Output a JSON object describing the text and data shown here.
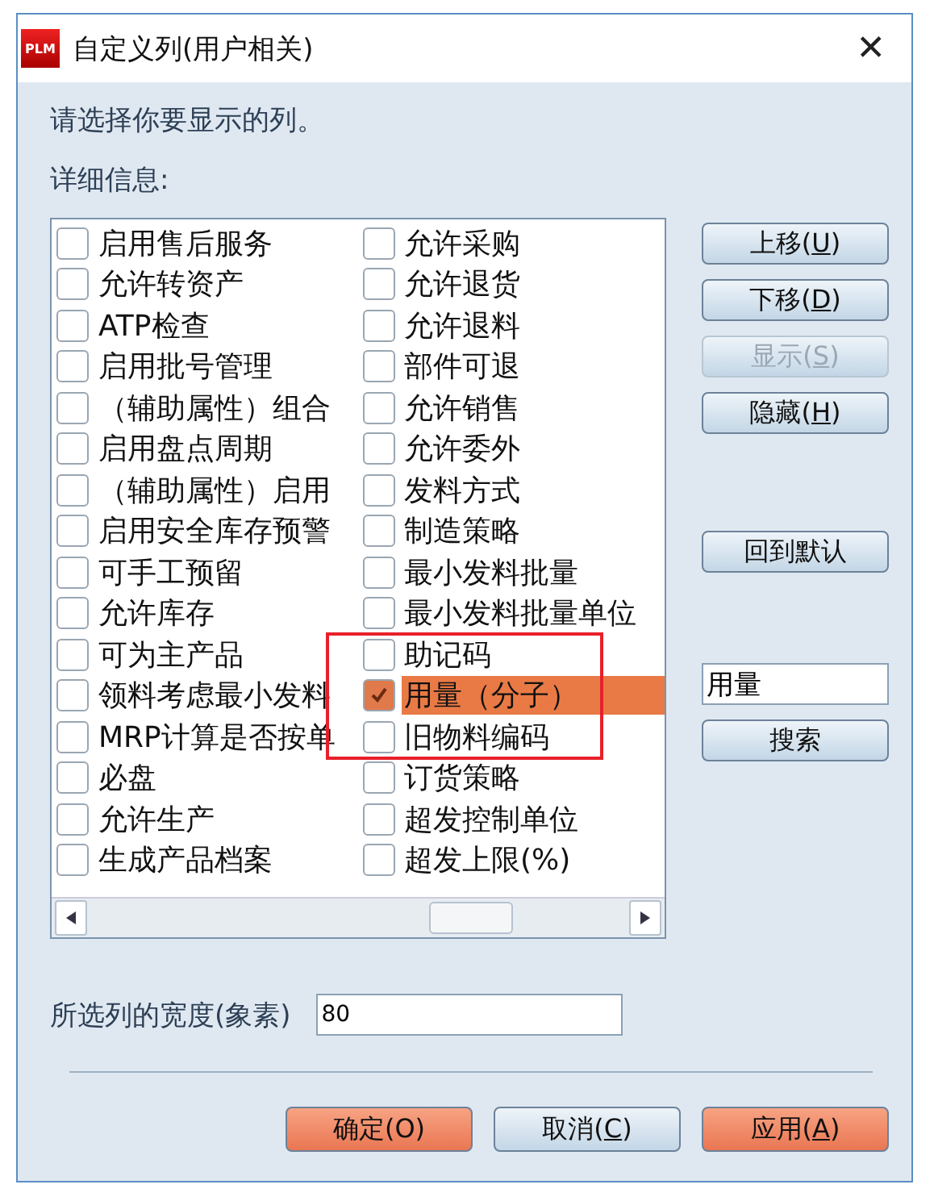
{
  "window": {
    "title": "自定义列(用户相关)",
    "logo": "PLM",
    "close": "✕"
  },
  "prompt": "请选择你要显示的列。",
  "details_label": "详细信息:",
  "columns": [
    [
      {
        "label": "启用售后服务",
        "checked": false,
        "selected": false
      },
      {
        "label": "允许转资产",
        "checked": false,
        "selected": false
      },
      {
        "label": "ATP检查",
        "checked": false,
        "selected": false
      },
      {
        "label": "启用批号管理",
        "checked": false,
        "selected": false
      },
      {
        "label": "（辅助属性）组合",
        "checked": false,
        "selected": false
      },
      {
        "label": "启用盘点周期",
        "checked": false,
        "selected": false
      },
      {
        "label": "（辅助属性）启用",
        "checked": false,
        "selected": false
      },
      {
        "label": "启用安全库存预警",
        "checked": false,
        "selected": false
      },
      {
        "label": "可手工预留",
        "checked": false,
        "selected": false
      },
      {
        "label": "允许库存",
        "checked": false,
        "selected": false
      },
      {
        "label": "可为主产品",
        "checked": false,
        "selected": false
      },
      {
        "label": "领料考虑最小发料",
        "checked": false,
        "selected": false
      },
      {
        "label": "MRP计算是否按单",
        "checked": false,
        "selected": false
      },
      {
        "label": "必盘",
        "checked": false,
        "selected": false
      },
      {
        "label": "允许生产",
        "checked": false,
        "selected": false
      },
      {
        "label": "生成产品档案",
        "checked": false,
        "selected": false
      }
    ],
    [
      {
        "label": "允许采购",
        "checked": false,
        "selected": false
      },
      {
        "label": "允许退货",
        "checked": false,
        "selected": false
      },
      {
        "label": "允许退料",
        "checked": false,
        "selected": false
      },
      {
        "label": "部件可退",
        "checked": false,
        "selected": false
      },
      {
        "label": "允许销售",
        "checked": false,
        "selected": false
      },
      {
        "label": "允许委外",
        "checked": false,
        "selected": false
      },
      {
        "label": "发料方式",
        "checked": false,
        "selected": false
      },
      {
        "label": "制造策略",
        "checked": false,
        "selected": false
      },
      {
        "label": "最小发料批量",
        "checked": false,
        "selected": false
      },
      {
        "label": "最小发料批量单位",
        "checked": false,
        "selected": false
      },
      {
        "label": "助记码",
        "checked": false,
        "selected": false
      },
      {
        "label": "用量（分子）",
        "checked": true,
        "selected": true
      },
      {
        "label": "旧物料编码",
        "checked": false,
        "selected": false
      },
      {
        "label": "订货策略",
        "checked": false,
        "selected": false
      },
      {
        "label": "超发控制单位",
        "checked": false,
        "selected": false
      },
      {
        "label": "超发上限(%)",
        "checked": false,
        "selected": false
      }
    ]
  ],
  "side_buttons": [
    {
      "kind": "button",
      "before": "上移(",
      "key": "U",
      "after": ")",
      "disabled": false
    },
    {
      "kind": "button",
      "before": "下移(",
      "key": "D",
      "after": ")",
      "disabled": false
    },
    {
      "kind": "button",
      "before": "显示(",
      "key": "S",
      "after": ")",
      "disabled": true
    },
    {
      "kind": "button",
      "before": "隐藏(",
      "key": "H",
      "after": ")",
      "disabled": false
    },
    {
      "kind": "gap"
    },
    {
      "kind": "button",
      "before": "回到默认",
      "disabled": false
    },
    {
      "kind": "gap"
    },
    {
      "kind": "field",
      "value": "用量"
    },
    {
      "kind": "button",
      "before": "搜索",
      "disabled": false
    }
  ],
  "width_field": {
    "label": "所选列的宽度(象素)",
    "value": "80"
  },
  "footer_buttons": [
    {
      "before": "确定(O)",
      "primary": true
    },
    {
      "before": "取消(",
      "key": "C",
      "after": ")",
      "primary": false
    },
    {
      "before": "应用(",
      "key": "A",
      "after": ")",
      "primary": true
    }
  ]
}
